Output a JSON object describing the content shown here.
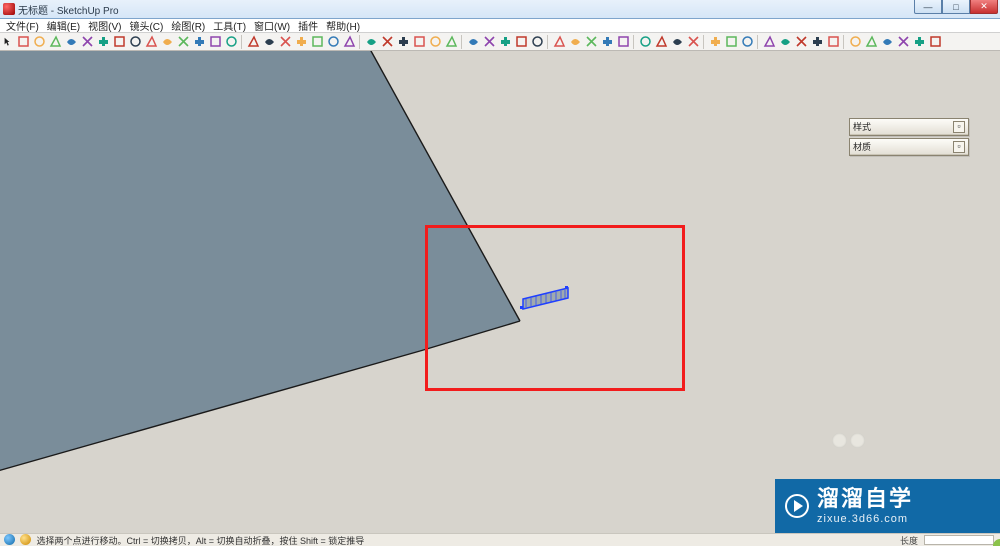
{
  "title": "无标题 - SketchUp Pro",
  "menus": [
    "文件(F)",
    "编辑(E)",
    "视图(V)",
    "镜头(C)",
    "绘图(R)",
    "工具(T)",
    "窗口(W)",
    "插件",
    "帮助(H)"
  ],
  "toolbar_icons": [
    "select",
    "line",
    "rect",
    "circle",
    "arc",
    "∿",
    "eraser",
    "tape",
    "paint",
    "pushpull",
    "move",
    "rotate",
    "scale",
    "offset",
    "|",
    "orbit",
    "pan",
    "zoom",
    "zoom-extents",
    "zoom-window",
    "prev",
    "next",
    "|",
    "iso",
    "top",
    "front",
    "right",
    "back",
    "left",
    "|",
    "section",
    "axes",
    "dim",
    "text",
    "3dtext",
    "|",
    "layers",
    "outliner",
    "components",
    "materials",
    "styles",
    "|",
    "shadow",
    "fog",
    "xray",
    "hidden",
    "|",
    "walk",
    "lookaround",
    "position",
    "|",
    "addloc",
    "getmodels",
    "share",
    "export",
    "print",
    "|",
    "undo",
    "redo",
    "cut",
    "copy",
    "paste",
    "delete"
  ],
  "panels": {
    "styles": "样式",
    "materials": "材质"
  },
  "status": {
    "hint": "选择两个点进行移动。Ctrl = 切换拷贝，Alt = 切换自动折叠，按住 Shift = 锁定推导",
    "length_label": "长度"
  },
  "watermark": {
    "main": "溜溜自学",
    "sub": "zixue.3d66.com"
  },
  "colors": {
    "face": "#7a8d9a",
    "edge": "#1a1a1a",
    "select": "#1f3fff",
    "highlight": "#f21c1c"
  }
}
